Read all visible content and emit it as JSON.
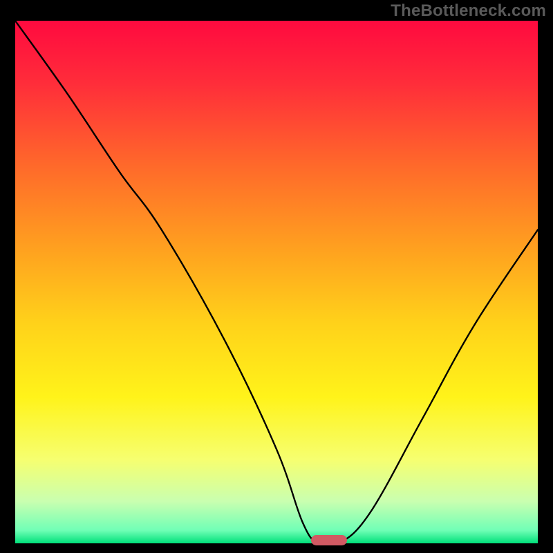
{
  "watermark": "TheBottleneck.com",
  "marker_color": "#d15a63",
  "chart_data": {
    "type": "line",
    "title": "",
    "xlabel": "",
    "ylabel": "",
    "xlim": [
      0,
      100
    ],
    "ylim": [
      0,
      100
    ],
    "x": [
      0,
      10,
      20,
      28,
      40,
      50,
      55,
      58,
      62,
      68,
      78,
      88,
      100
    ],
    "values": [
      100,
      86,
      71,
      60,
      39,
      18,
      4,
      0,
      0,
      6,
      24,
      42,
      60
    ],
    "flat_zone": [
      57,
      63
    ],
    "marker_x": 60,
    "gradient_stops": [
      {
        "offset": 0.0,
        "color": "#ff0a3f"
      },
      {
        "offset": 0.12,
        "color": "#ff2d3a"
      },
      {
        "offset": 0.28,
        "color": "#ff6a2a"
      },
      {
        "offset": 0.44,
        "color": "#ffa21f"
      },
      {
        "offset": 0.58,
        "color": "#ffd21a"
      },
      {
        "offset": 0.72,
        "color": "#fff31a"
      },
      {
        "offset": 0.84,
        "color": "#f6ff70"
      },
      {
        "offset": 0.92,
        "color": "#c9ffb0"
      },
      {
        "offset": 0.975,
        "color": "#70ffb6"
      },
      {
        "offset": 1.0,
        "color": "#00e07a"
      }
    ]
  }
}
